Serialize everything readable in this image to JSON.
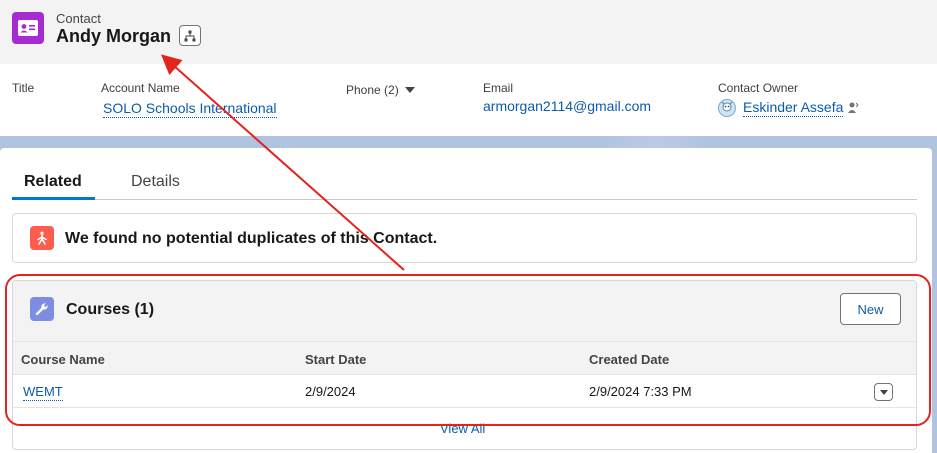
{
  "header": {
    "object_label": "Contact",
    "record_name": "Andy Morgan",
    "record_icon": "contact-card-icon",
    "hierarchy_icon": "hierarchy-icon"
  },
  "highlights": {
    "title_label": "Title",
    "account_label": "Account Name",
    "account_value": "SOLO Schools International",
    "phone_label": "Phone (2)",
    "email_label": "Email",
    "email_value": "armorgan2114@gmail.com",
    "owner_label": "Contact Owner",
    "owner_value": "Eskinder Assefa",
    "owner_icon": "user-avatar-icon",
    "change_owner_icon": "change-owner-icon"
  },
  "tabs": [
    {
      "label": "Related",
      "active": true
    },
    {
      "label": "Details",
      "active": false
    }
  ],
  "duplicates": {
    "icon": "duplicate-alert-icon",
    "message": "We found no potential duplicates of this Contact."
  },
  "courses": {
    "icon": "wrench-icon",
    "title": "Courses (1)",
    "new_label": "New",
    "columns": [
      "Course Name",
      "Start Date",
      "Created Date"
    ],
    "rows": [
      {
        "course_name": "WEMT",
        "start_date": "2/9/2024",
        "created_date": "2/9/2024 7:33 PM"
      }
    ],
    "view_all": "View All"
  },
  "colors": {
    "brand_blue": "#0176d3",
    "link_blue": "#0b5cab",
    "contact_purple": "#a82ad3",
    "duplicate_orange": "#fe5c4c",
    "annotation_red": "#e3231c"
  }
}
